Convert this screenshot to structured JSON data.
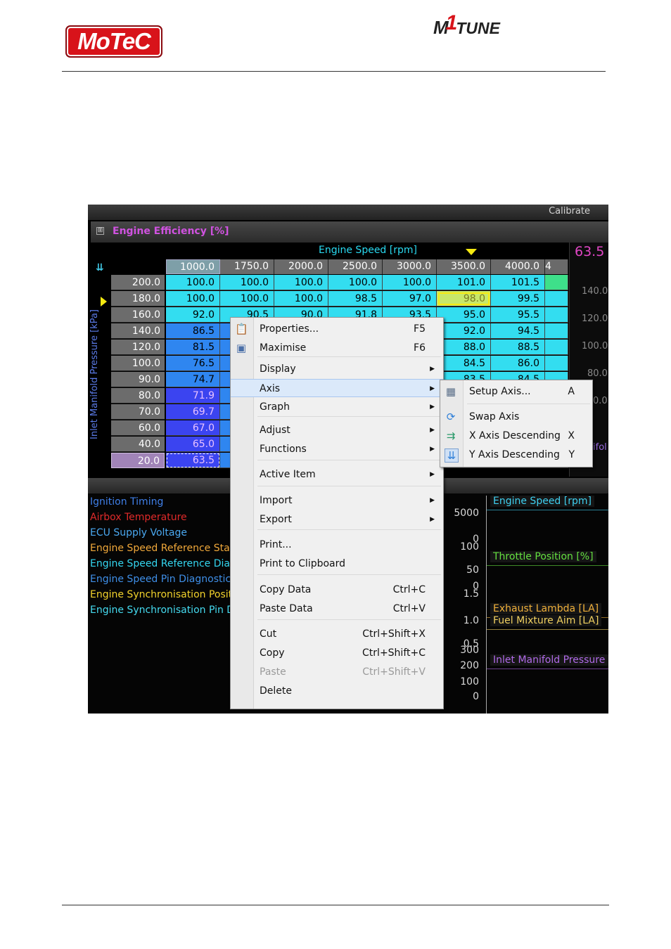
{
  "header": {
    "logo_left": "MoTeC",
    "logo_right_m": "M",
    "logo_right_one": "1",
    "logo_right_tune": "TUNE"
  },
  "app": {
    "calibrate_label": "Calibrate",
    "panel_title": "Engine Efficiency [%]",
    "expand_glyph": "⊞",
    "x_axis_title": "Engine Speed [rpm]",
    "y_axis_title": "Inlet Manifold Pressure [kPa]",
    "current_value": "63.5",
    "right_axis_ticks": [
      "140.0",
      "120.0",
      "100.0",
      "80.0",
      "0.0"
    ],
    "right_axis_partial_label": "ifol"
  },
  "table": {
    "x_headers": [
      "1000.0",
      "1750.0",
      "2000.0",
      "2500.0",
      "3000.0",
      "3500.0",
      "4000.0",
      "4"
    ],
    "y_headers": [
      "200.0",
      "180.0",
      "160.0",
      "140.0",
      "120.0",
      "100.0",
      "90.0",
      "80.0",
      "70.0",
      "60.0",
      "40.0",
      "20.0"
    ],
    "rows": [
      [
        "100.0",
        "100.0",
        "100.0",
        "100.0",
        "100.0",
        "101.0",
        "101.5"
      ],
      [
        "100.0",
        "100.0",
        "100.0",
        "98.5",
        "97.0",
        "98.0",
        "99.5"
      ],
      [
        "92.0",
        "90.5",
        "90.0",
        "91.8",
        "93.5",
        "95.0",
        "95.5"
      ],
      [
        "86.5",
        "",
        "",
        "",
        "",
        "92.0",
        "94.5"
      ],
      [
        "81.5",
        "",
        "",
        "",
        "",
        "88.0",
        "88.5"
      ],
      [
        "76.5",
        "",
        "",
        "",
        "",
        "84.5",
        "86.0"
      ],
      [
        "74.7",
        "",
        "",
        "",
        "",
        "83.5",
        "84.5"
      ],
      [
        "71.9",
        "",
        "",
        "",
        "",
        "",
        ""
      ],
      [
        "69.7",
        "",
        "",
        "",
        "",
        "",
        ""
      ],
      [
        "67.0",
        "",
        "",
        "",
        "",
        "",
        ""
      ],
      [
        "65.0",
        "",
        "",
        "",
        "",
        "",
        ""
      ],
      [
        "63.5",
        "",
        "",
        "",
        "",
        "",
        ""
      ]
    ],
    "selected_cell": "63.5",
    "highlighted_cell": "98.0"
  },
  "channels": [
    {
      "label": "Ignition Timing",
      "color": "#3f7fe8"
    },
    {
      "label": "Airbox Temperature",
      "color": "#e02a2a"
    },
    {
      "label": "ECU Supply Voltage",
      "color": "#4aa8f0"
    },
    {
      "label": "Engine Speed Reference Stat",
      "color": "#f0a83a"
    },
    {
      "label": "Engine Speed Reference Diag",
      "color": "#34d6f0"
    },
    {
      "label": "Engine Speed Pin Diagnostic",
      "color": "#3f8fe8"
    },
    {
      "label": "Engine Synchronisation Positic",
      "color": "#f2d22c"
    },
    {
      "label": "Engine Synchronisation Pin Di",
      "color": "#45dbf0"
    }
  ],
  "graph": {
    "ticks": [
      "5000",
      "0",
      "100",
      "50",
      "0",
      "1.5",
      "1.0",
      "0.5",
      "300",
      "200",
      "100",
      "0"
    ],
    "traces": [
      {
        "label": "Engine Speed [rpm]",
        "color": "#3fd0f0"
      },
      {
        "label": "Throttle Position [%]",
        "color": "#64e040"
      },
      {
        "label": "Exhaust Lambda [LA]",
        "color": "#f0b03a"
      },
      {
        "label": "Fuel Mixture Aim [LA]",
        "color": "#f0d060"
      },
      {
        "label": "Inlet Manifold Pressure [",
        "color": "#b06ae8"
      }
    ]
  },
  "context_menu": {
    "items": [
      {
        "label": "Properties...",
        "shortcut": "F5",
        "icon": "properties-icon"
      },
      {
        "label": "Maximise",
        "shortcut": "F6",
        "icon": "maximise-icon"
      },
      {
        "label": "Display",
        "submenu": true
      },
      {
        "label": "Axis",
        "submenu": true,
        "highlighted": true
      },
      {
        "label": "Graph",
        "submenu": true
      },
      {
        "label": "Adjust",
        "submenu": true
      },
      {
        "label": "Functions",
        "submenu": true
      },
      {
        "label": "Active Item",
        "submenu": true
      },
      {
        "label": "Import",
        "submenu": true
      },
      {
        "label": "Export",
        "submenu": true
      },
      {
        "label": "Print..."
      },
      {
        "label": "Print to Clipboard"
      },
      {
        "label": "Copy Data",
        "shortcut": "Ctrl+C"
      },
      {
        "label": "Paste Data",
        "shortcut": "Ctrl+V"
      },
      {
        "label": "Cut",
        "shortcut": "Ctrl+Shift+X"
      },
      {
        "label": "Copy",
        "shortcut": "Ctrl+Shift+C"
      },
      {
        "label": "Paste",
        "shortcut": "Ctrl+Shift+V",
        "disabled": true
      },
      {
        "label": "Delete"
      }
    ]
  },
  "axis_submenu": {
    "items": [
      {
        "label": "Setup Axis...",
        "shortcut": "A",
        "icon": "setup-axis-icon"
      },
      {
        "label": "Swap Axis",
        "icon": "swap-axis-icon"
      },
      {
        "label": "X Axis Descending",
        "shortcut": "X",
        "icon": "x-axis-descending-icon"
      },
      {
        "label": "Y Axis Descending",
        "shortcut": "Y",
        "icon": "y-axis-descending-icon"
      }
    ]
  },
  "colors": {
    "cell_cyan": "#33ddf0",
    "cell_blue": "#2f86f0",
    "cell_deep_blue": "#3b44f0",
    "selection_yellow": "#f6ea11",
    "menu_highlight": "#dbe9fa"
  }
}
